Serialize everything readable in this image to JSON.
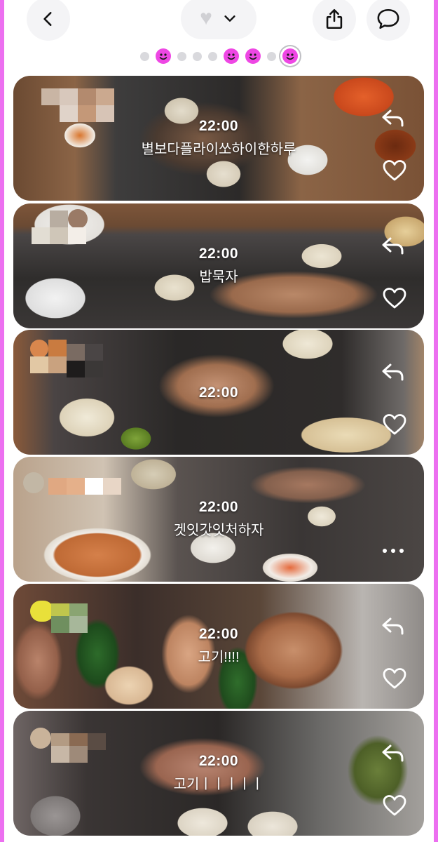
{
  "header": {
    "back_icon": "chevron-left-icon",
    "filter_icon": "heart-icon",
    "dropdown_icon": "chevron-down-icon",
    "share_icon": "share-icon",
    "chat_icon": "chat-bubble-icon"
  },
  "dots": [
    "dot",
    "smile",
    "dot",
    "dot",
    "dot",
    "smile",
    "smile",
    "dot",
    "smile-active"
  ],
  "accent_color": "#ee47e4",
  "frame_color": "#ec6ff0",
  "posts": [
    {
      "time": "22:00",
      "caption": "별보다플라이쏘하이한하루",
      "action": "reply"
    },
    {
      "time": "22:00",
      "caption": "밥묵자",
      "action": "reply"
    },
    {
      "time": "22:00",
      "caption": "",
      "action": "reply"
    },
    {
      "time": "22:00",
      "caption": "겟잇갓잇처하자",
      "action": "more"
    },
    {
      "time": "22:00",
      "caption": "고기!!!!",
      "action": "reply"
    },
    {
      "time": "22:00",
      "caption": "고기ㅣㅣㅣㅣㅣ",
      "action": "reply"
    }
  ]
}
